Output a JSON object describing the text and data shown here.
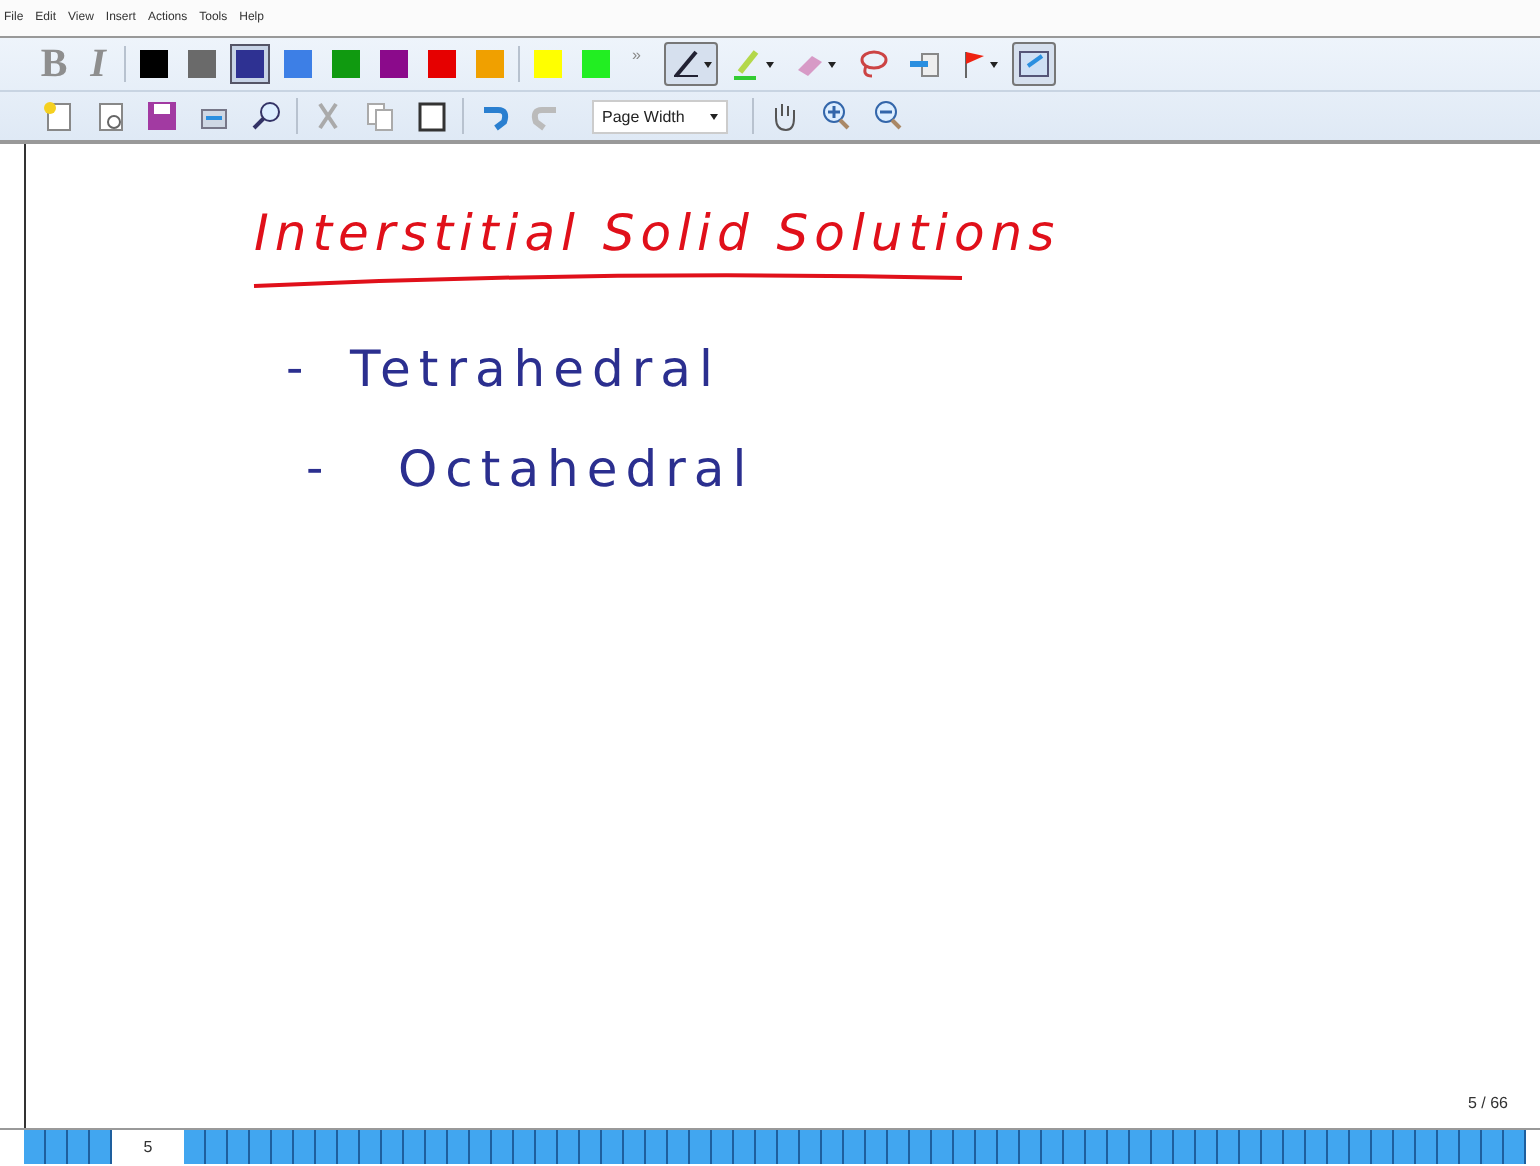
{
  "menu": [
    "File",
    "Edit",
    "View",
    "Insert",
    "Actions",
    "Tools",
    "Help"
  ],
  "format_buttons": [
    {
      "label": "B",
      "disabled": true
    },
    {
      "label": "I",
      "disabled": true
    }
  ],
  "colors": [
    {
      "color": "#000000",
      "selected": false
    },
    {
      "color": "#6a6a6a",
      "selected": false
    },
    {
      "color": "#2e3192",
      "selected": true
    },
    {
      "color": "#3d7fe6",
      "selected": false
    },
    {
      "color": "#109a10",
      "selected": false
    },
    {
      "color": "#8b0a8b",
      "selected": false
    },
    {
      "color": "#e60000",
      "selected": false
    },
    {
      "color": "#f0a000",
      "selected": false
    },
    {
      "color": "#ffff00",
      "selected": false
    },
    {
      "color": "#22ee22",
      "selected": false
    }
  ],
  "more": "»",
  "tools": [
    {
      "kind": "pen",
      "selected": true,
      "dropdown": true
    },
    {
      "kind": "highlighter",
      "selected": false,
      "dropdown": true
    },
    {
      "kind": "eraser",
      "selected": false,
      "dropdown": true
    },
    {
      "kind": "lasso",
      "selected": false,
      "dropdown": false
    },
    {
      "kind": "insert",
      "selected": false,
      "dropdown": false
    },
    {
      "kind": "flag",
      "selected": false,
      "dropdown": true
    },
    {
      "kind": "view",
      "selected": true,
      "dropdown": false
    }
  ],
  "file_tools": [
    {
      "kind": "new"
    },
    {
      "kind": "open"
    },
    {
      "kind": "save"
    },
    {
      "kind": "send"
    },
    {
      "kind": "find"
    },
    {
      "kind": "sep"
    },
    {
      "kind": "cut"
    },
    {
      "kind": "copy"
    },
    {
      "kind": "paste"
    },
    {
      "kind": "sep"
    },
    {
      "kind": "undo"
    },
    {
      "kind": "redo"
    }
  ],
  "zoom": {
    "value": "Page Width"
  },
  "view_tools": [
    {
      "kind": "hand"
    },
    {
      "kind": "zoomin"
    },
    {
      "kind": "zoomout"
    }
  ],
  "note": {
    "title": "Interstitial Solid Solutions",
    "items": [
      {
        "bullet": "-",
        "text": "Tetrahedral"
      },
      {
        "bullet": "-",
        "text": "Octahedral"
      }
    ]
  },
  "page_counter": "5 / 66",
  "page_strip": {
    "current": "5"
  }
}
